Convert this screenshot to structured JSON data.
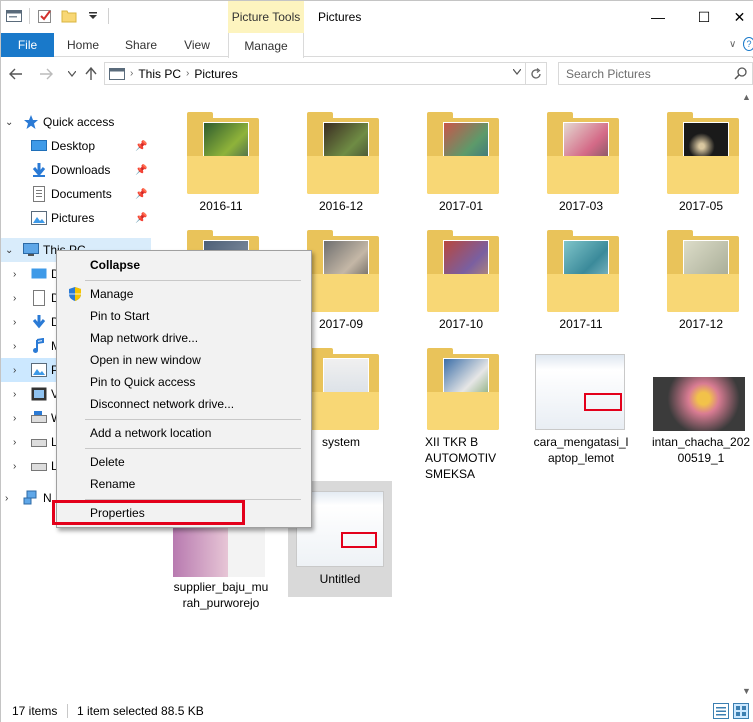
{
  "window": {
    "title": "Pictures",
    "contextual_tab": "Picture Tools",
    "controls": {
      "minimize": "—",
      "maximize": "☐",
      "close": "✕"
    }
  },
  "ribbon": {
    "tabs": [
      "File",
      "Home",
      "Share",
      "View",
      "Manage"
    ]
  },
  "address": {
    "crumbs": [
      "This PC",
      "Pictures"
    ],
    "search_placeholder": "Search Pictures"
  },
  "nav": {
    "quick_access": "Quick access",
    "pinned": [
      "Desktop",
      "Downloads",
      "Documents",
      "Pictures"
    ],
    "this_pc": "This PC",
    "network_partial": "N",
    "truncated_children": [
      "D",
      "D",
      "D",
      "M",
      "P",
      "V",
      "W",
      "L",
      "L"
    ]
  },
  "items": [
    {
      "label": "2016-11",
      "type": "folder"
    },
    {
      "label": "2016-12",
      "type": "folder"
    },
    {
      "label": "2017-01",
      "type": "folder"
    },
    {
      "label": "2017-03",
      "type": "folder"
    },
    {
      "label": "2017-05",
      "type": "folder"
    },
    {
      "label": "2017-09",
      "type": "folder"
    },
    {
      "label": "2017-10",
      "type": "folder"
    },
    {
      "label": "2017-11",
      "type": "folder"
    },
    {
      "label": "2017-12",
      "type": "folder"
    },
    {
      "label": "system",
      "type": "folder"
    },
    {
      "label_lines": [
        "XII TKR B",
        "AUTOMOTIV",
        "SMEKSA"
      ],
      "type": "folder"
    },
    {
      "label_lines": [
        "cara_mengatasi_l",
        "aptop_lemot"
      ],
      "type": "image"
    },
    {
      "label_lines": [
        "intan_chacha_202",
        "00519_1"
      ],
      "type": "image"
    },
    {
      "label_lines": [
        "supplier_baju_mu",
        "rah_purworejo"
      ],
      "type": "image"
    },
    {
      "label": "Untitled",
      "type": "image",
      "selected": true
    }
  ],
  "context_menu": {
    "items": [
      "Collapse",
      "Manage",
      "Pin to Start",
      "Map network drive...",
      "Open in new window",
      "Pin to Quick access",
      "Disconnect network drive...",
      "Add a network location",
      "Delete",
      "Rename",
      "Properties"
    ]
  },
  "status": {
    "count": "17 items",
    "selection": "1 item selected  88.5 KB"
  },
  "colors": {
    "accent": "#1979ca",
    "selection": "#cce8ff",
    "highlight_box": "#e3001b",
    "folder": "#f8d775"
  }
}
